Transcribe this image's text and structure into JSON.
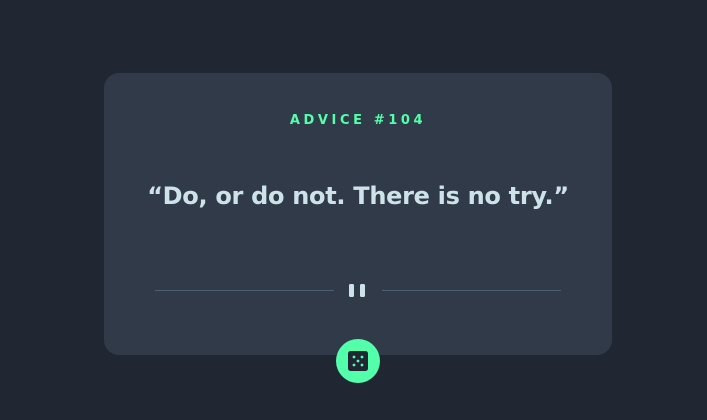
{
  "advice": {
    "heading": "ADVICE #104",
    "quote": "“Do, or do not. There is no try.”"
  },
  "divider": {
    "icon": "pause-icon"
  },
  "dice_button": {
    "icon": "dice-icon"
  },
  "colors": {
    "background": "#202632",
    "card": "#313a48",
    "accent": "#53ffaa",
    "text": "#cee3e9",
    "divider": "#4f5d74"
  }
}
